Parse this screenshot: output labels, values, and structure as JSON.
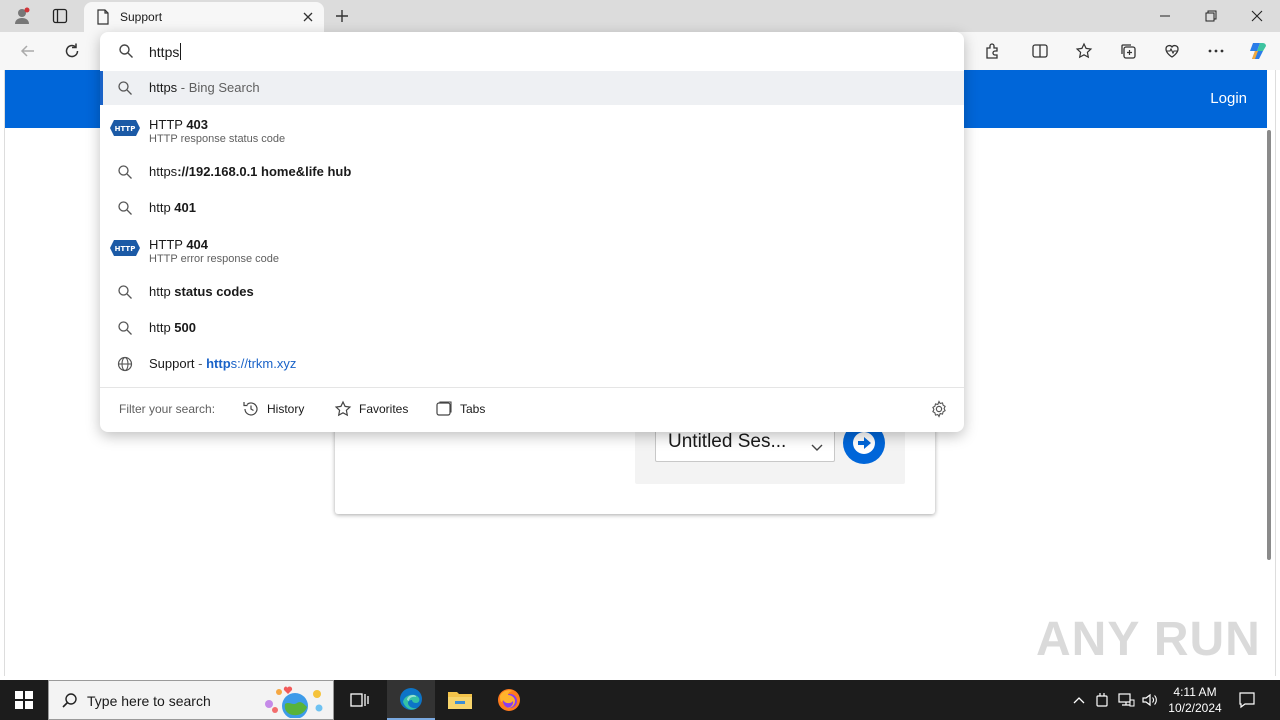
{
  "browser": {
    "tab_title": "Support",
    "address_value": "https",
    "window_controls": [
      "minimize",
      "restore",
      "close"
    ],
    "toolbar_icons": [
      "extensions-icon",
      "split-screen-icon",
      "favorites-icon",
      "collections-icon",
      "browser-essentials-icon",
      "more-icon",
      "copilot-icon"
    ]
  },
  "omnibox": {
    "suggestions": [
      {
        "kind": "search",
        "bold": "",
        "plain": "https",
        "suffix": " - Bing Search",
        "selected": true
      },
      {
        "kind": "http",
        "plain": "HTTP ",
        "bold": "403",
        "sub": "HTTP response status code"
      },
      {
        "kind": "search",
        "plain": "https",
        "bold": "://192.168.0.1 home&life hub"
      },
      {
        "kind": "search",
        "plain": "http ",
        "bold": "401"
      },
      {
        "kind": "http",
        "plain": "HTTP ",
        "bold": "404",
        "sub": "HTTP error response code"
      },
      {
        "kind": "search",
        "plain": "http ",
        "bold": "status codes"
      },
      {
        "kind": "search",
        "plain": "http ",
        "bold": "500"
      },
      {
        "kind": "site",
        "plain": "Support",
        "sep": " - ",
        "link_bold": "http",
        "link_rest": "s://trkm.xyz"
      }
    ],
    "filter_label": "Filter your search:",
    "filters": [
      {
        "label": "History",
        "icon": "history-icon"
      },
      {
        "label": "Favorites",
        "icon": "star-icon"
      },
      {
        "label": "Tabs",
        "icon": "tabs-icon"
      }
    ],
    "http_badge": "HTTP"
  },
  "page": {
    "login_label": "Login",
    "session_value": "Untitled Ses...",
    "header_color": "#0066d9"
  },
  "watermark": "ANY RUN",
  "taskbar": {
    "search_placeholder": "Type here to search",
    "time": "4:11 AM",
    "date": "10/2/2024"
  }
}
